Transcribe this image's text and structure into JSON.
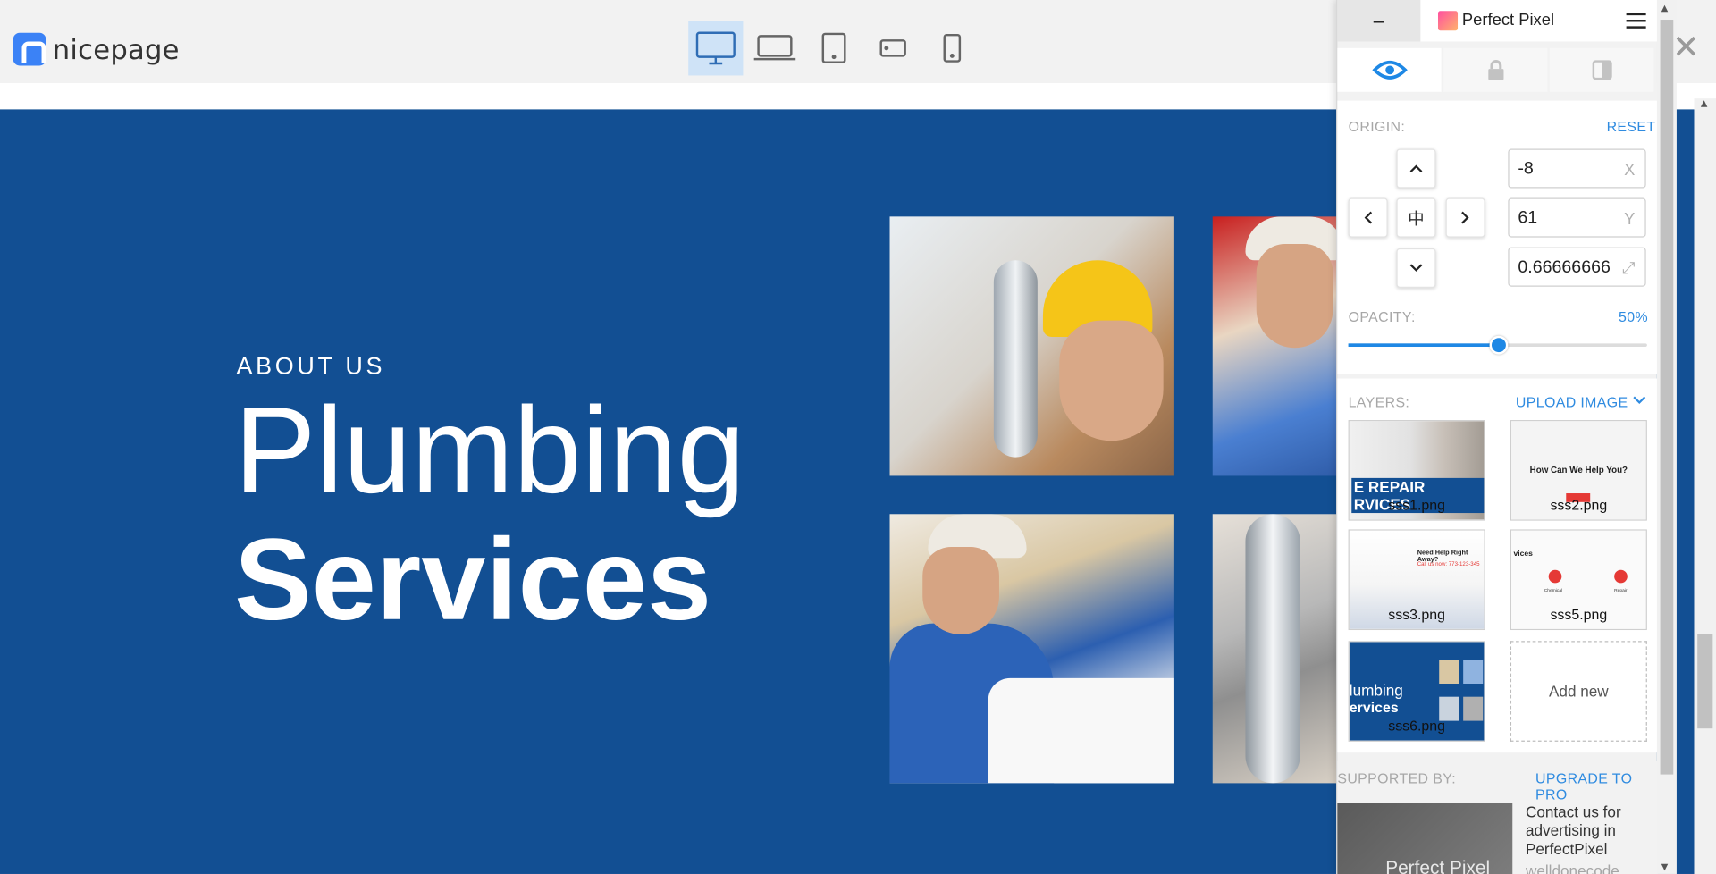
{
  "app": {
    "logo_text": "nicepage",
    "close_glyph": "✕"
  },
  "devices": [
    {
      "name": "desktop",
      "active": true
    },
    {
      "name": "laptop",
      "active": false
    },
    {
      "name": "tablet",
      "active": false
    },
    {
      "name": "phone-landscape",
      "active": false
    },
    {
      "name": "phone",
      "active": false
    }
  ],
  "hero": {
    "kicker": "ABOUT US",
    "title_line1": "Plumbing",
    "title_line2": "Services",
    "background": "#124f93"
  },
  "perfect_pixel": {
    "minimize": "–",
    "title": "Perfect Pixel",
    "tabs": [
      "eye-icon",
      "lock-icon",
      "invert-icon"
    ],
    "origin_label": "ORIGIN:",
    "reset_label": "RESET",
    "x_value": "-8",
    "x_unit": "X",
    "y_value": "61",
    "y_unit": "Y",
    "scale_value": "0.66666666",
    "center_glyph": "中",
    "opacity_label": "OPACITY:",
    "opacity_value": "50%",
    "opacity_fraction": 0.5,
    "layers_label": "LAYERS:",
    "upload_label": "UPLOAD IMAGE",
    "layers": [
      {
        "name": "sss1.png"
      },
      {
        "name": "sss2.png"
      },
      {
        "name": "sss3.png"
      },
      {
        "name": "sss5.png"
      },
      {
        "name": "sss6.png"
      }
    ],
    "add_new_label": "Add new",
    "supported_label": "SUPPORTED BY:",
    "upgrade_label": "UPGRADE TO PRO",
    "ad_image_text": "Perfect Pixel",
    "ad_text": "Contact us for advertising in PerfectPixel",
    "ad_more": "welldonecode"
  },
  "thumbs_text": {
    "t1_band": "E REPAIR RVICES",
    "t2_heading": "How Can We Help You?",
    "t3_heading": "Need Help Right Away?",
    "t3_sub": "Call us now: 773-123-345",
    "t5_heading": "vices",
    "t5_item1": "Chemical",
    "t5_item2": "Repair",
    "t6_line1": "lumbing",
    "t6_line2": "ervices"
  },
  "colors": {
    "accent": "#1e88e5",
    "link": "#2f8be0",
    "hero_bg": "#124f93"
  }
}
